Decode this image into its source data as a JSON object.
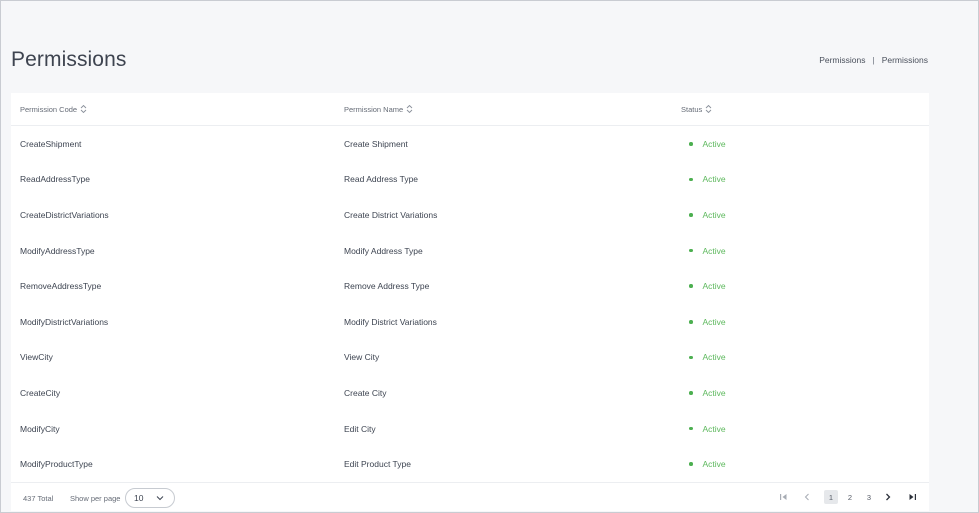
{
  "page": {
    "title": "Permissions",
    "breadcrumb": [
      "Permissions",
      "Permissions"
    ],
    "breadcrumb_separator": "|"
  },
  "table": {
    "columns": [
      "Permission Code",
      "Permission Name",
      "Status"
    ],
    "rows": [
      {
        "code": "CreateShipment",
        "name": "Create Shipment",
        "status": "Active"
      },
      {
        "code": "ReadAddressType",
        "name": "Read Address Type",
        "status": "Active"
      },
      {
        "code": "CreateDistrictVariations",
        "name": "Create District Variations",
        "status": "Active"
      },
      {
        "code": "ModifyAddressType",
        "name": "Modify Address Type",
        "status": "Active"
      },
      {
        "code": "RemoveAddressType",
        "name": "Remove Address Type",
        "status": "Active"
      },
      {
        "code": "ModifyDistrictVariations",
        "name": "Modify District Variations",
        "status": "Active"
      },
      {
        "code": "ViewCity",
        "name": "View City",
        "status": "Active"
      },
      {
        "code": "CreateCity",
        "name": "Create City",
        "status": "Active"
      },
      {
        "code": "ModifyCity",
        "name": "Edit City",
        "status": "Active"
      },
      {
        "code": "ModifyProductType",
        "name": "Edit Product Type",
        "status": "Active"
      }
    ]
  },
  "footer": {
    "total": "437 Total",
    "per_page_label": "Show per page",
    "per_page_value": "10",
    "pages": [
      "1",
      "2",
      "3"
    ],
    "current_page": "1"
  },
  "colors": {
    "status_active": "#5cb85c",
    "status_dot": "#4caf50",
    "background": "#f6f7f9"
  },
  "icons": {
    "sort": "sort-updown-icon",
    "select_chevron": "chevron-down-icon",
    "first": "first-page-icon",
    "prev": "chevron-left-icon",
    "next": "chevron-right-icon",
    "last": "last-page-icon"
  }
}
